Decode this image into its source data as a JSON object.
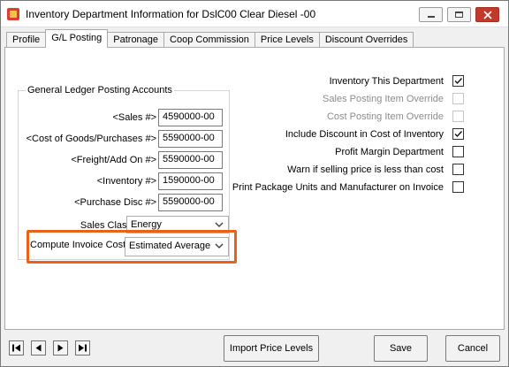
{
  "window": {
    "title": "Inventory Department Information for DslC00  Clear Diesel -00"
  },
  "tabs": [
    {
      "label": "Profile"
    },
    {
      "label": "G/L Posting"
    },
    {
      "label": "Patronage"
    },
    {
      "label": "Coop Commission"
    },
    {
      "label": "Price Levels"
    },
    {
      "label": "Discount Overrides"
    }
  ],
  "active_tab": "G/L Posting",
  "gl_accounts": {
    "title": "General Ledger Posting Accounts",
    "rows": [
      {
        "label": "<Sales #>",
        "value": "4590000-00"
      },
      {
        "label": "<Cost of Goods/Purchases #>",
        "value": "5590000-00"
      },
      {
        "label": "<Freight/Add On #>",
        "value": "5590000-00"
      },
      {
        "label": "<Inventory #>",
        "value": "1590000-00"
      },
      {
        "label": "<Purchase Disc #>",
        "value": "5590000-00"
      }
    ]
  },
  "sales_class": {
    "label": "Sales Class",
    "value": "Energy"
  },
  "compute_invoice_cost": {
    "label": "Compute Invoice Cost",
    "value": "Estimated Average"
  },
  "options": [
    {
      "label": "Inventory This Department",
      "checked": true,
      "enabled": true
    },
    {
      "label": "Sales Posting Item Override",
      "checked": false,
      "enabled": false
    },
    {
      "label": "Cost Posting Item Override",
      "checked": false,
      "enabled": false
    },
    {
      "label": "Include Discount in Cost of Inventory",
      "checked": true,
      "enabled": true
    },
    {
      "label": "Profit Margin Department",
      "checked": false,
      "enabled": true
    },
    {
      "label": "Warn if selling price is less than cost",
      "checked": false,
      "enabled": true
    },
    {
      "label": "Print Package Units and Manufacturer on Invoice",
      "checked": false,
      "enabled": true
    }
  ],
  "buttons": {
    "import": "Import Price Levels",
    "save": "Save",
    "cancel": "Cancel"
  },
  "colors": {
    "highlight": "#e8621a",
    "close_button": "#c0392b"
  }
}
